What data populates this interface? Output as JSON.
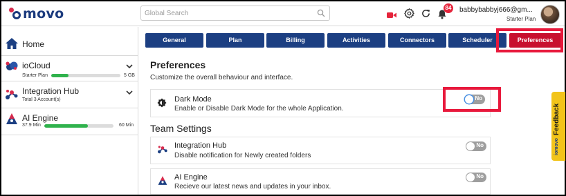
{
  "header": {
    "logo_text": "movo",
    "search_placeholder": "Global Search",
    "notification_count": "84",
    "user_email": "babbybabbyj666@gm...",
    "user_plan": "Starter Plan"
  },
  "sidebar": {
    "home": "Home",
    "items": [
      {
        "title": "ioCloud",
        "sub": "Starter Plan",
        "progress_fraction": 0.25,
        "value": "5 GB"
      },
      {
        "title": "Integration Hub",
        "sub": "Total 3 Account(s)"
      },
      {
        "title": "AI Engine",
        "sub": "37.9 Min",
        "progress_fraction": 0.63,
        "value": "60 Min"
      }
    ]
  },
  "tabs": [
    "General",
    "Plan",
    "Billing",
    "Activities",
    "Connectors",
    "Scheduler",
    "Preferences"
  ],
  "active_tab": "Preferences",
  "preferences": {
    "title": "Preferences",
    "description": "Customize the overall behaviour and interface.",
    "dark_mode": {
      "title": "Dark Mode",
      "desc": "Enable or Disable Dark Mode for the whole Application.",
      "toggle": "No"
    }
  },
  "team_settings": {
    "title": "Team Settings",
    "items": [
      {
        "title": "Integration Hub",
        "desc": "Disable notification for Newly created folders",
        "toggle": "No"
      },
      {
        "title": "AI Engine",
        "desc": "Recieve our latest news and updates in your inbox.",
        "toggle": "No"
      }
    ]
  },
  "feedback": {
    "label": "Feedback",
    "brand": "iomovo"
  },
  "colors": {
    "navy": "#1c3f82",
    "active_tab": "#c8102e",
    "highlight": "#e8193c",
    "progress": "#2fb24c",
    "feedback": "#f2c41a"
  }
}
